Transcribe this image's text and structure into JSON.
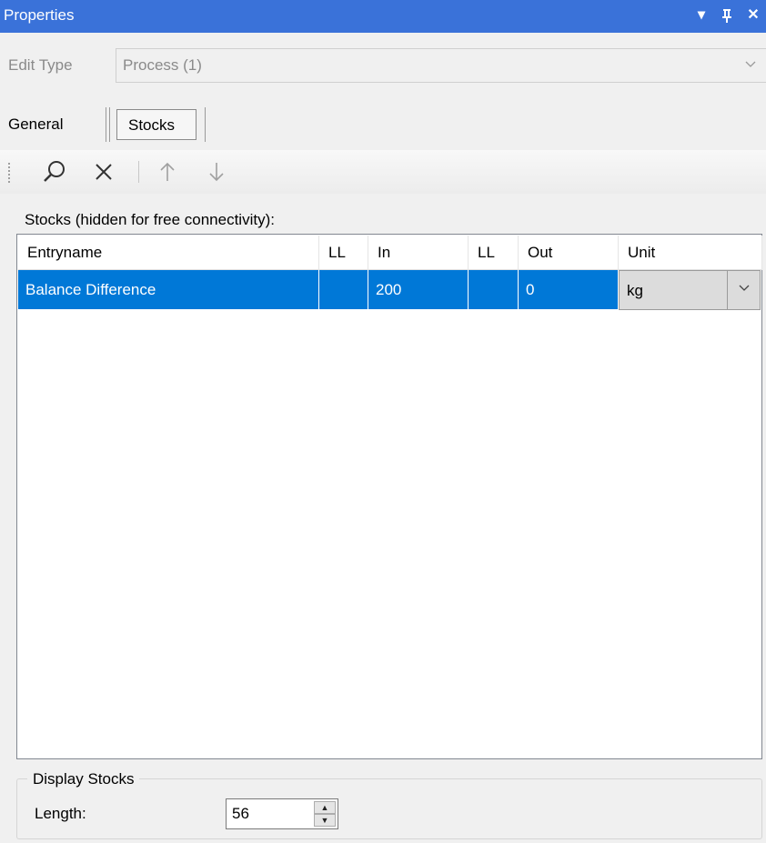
{
  "window": {
    "title": "Properties",
    "buttons": {
      "menu": "▾",
      "pin": "ᵽ",
      "close": "✕"
    }
  },
  "edit_type": {
    "label": "Edit Type",
    "value": "Process (1)"
  },
  "tabs": [
    {
      "label": "General",
      "selected": false
    },
    {
      "label": "Stocks",
      "selected": true
    }
  ],
  "toolbar": {
    "icons": [
      "search-icon",
      "close-icon",
      "arrow-up-icon",
      "arrow-down-icon"
    ]
  },
  "stocks": {
    "caption": "Stocks (hidden for free connectivity):",
    "columns": [
      "Entryname",
      "LL",
      "In",
      "LL",
      "Out",
      "Unit"
    ],
    "rows": [
      {
        "entryname": "Balance Difference",
        "ll_in": "",
        "in": "200",
        "ll_out": "",
        "out": "0",
        "unit": "kg"
      }
    ]
  },
  "display_stocks": {
    "title": "Display Stocks",
    "length_label": "Length:",
    "length_value": "56"
  },
  "colors": {
    "titlebar": "#3a72d9",
    "selection": "#0078d7"
  }
}
